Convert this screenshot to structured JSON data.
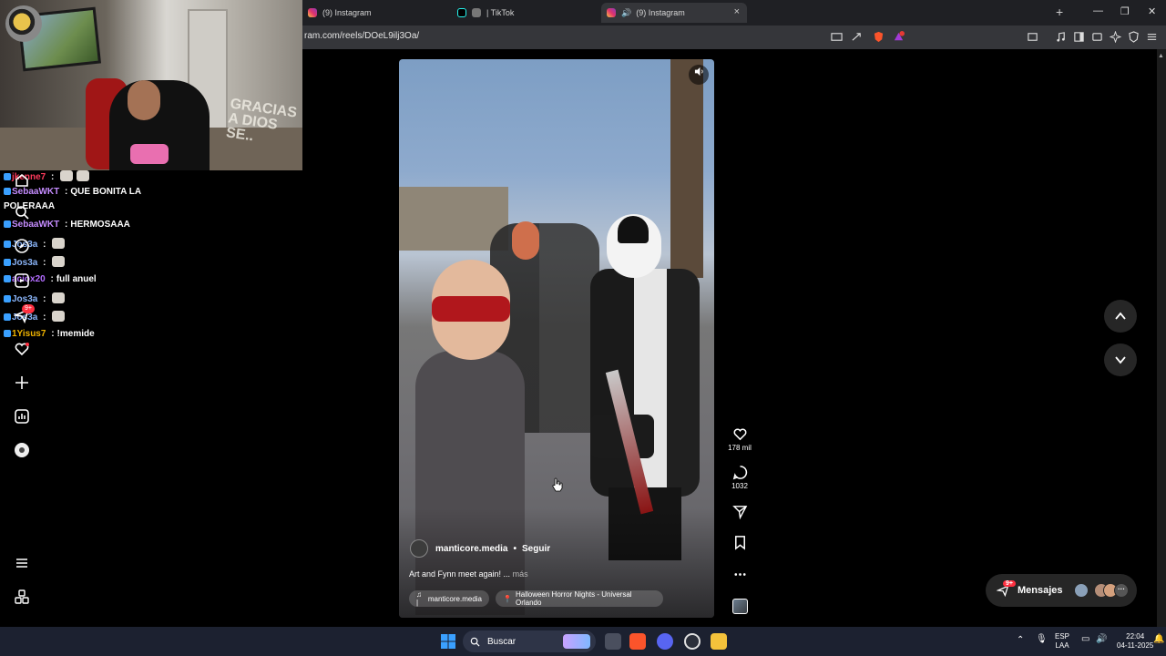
{
  "browser": {
    "tabs": [
      {
        "title": "(9) Instagram"
      },
      {
        "title": "| TikTok"
      },
      {
        "title": "(9) Instagram"
      }
    ],
    "url": "ram.com/reels/DOeL9ilj3Oa/",
    "new_tab_symbol": "+",
    "tab_close_symbol": "×",
    "window_controls": [
      "—",
      "❐",
      "✕"
    ]
  },
  "stream": {
    "wall_text": "GRACIAS A DIOS SE..",
    "chat": [
      {
        "user": "jkenne7",
        "user_color": "#ff3b5c",
        "sep": " :",
        "message": "",
        "emotes": 2
      },
      {
        "user": "SebaaWKT",
        "user_color": "#c58cff",
        "sep": " :",
        "message": "QUE BONITA LA",
        "emotes": 0
      },
      {
        "user": "",
        "user_color": "#ffffff",
        "sep": "",
        "message": "POLERAAA",
        "emotes": 0
      },
      {
        "user": "SebaaWKT",
        "user_color": "#c58cff",
        "sep": " :",
        "message": "HERMOSAAA",
        "emotes": 0
      },
      {
        "user": "Jos3a",
        "user_color": "#8ab4f8",
        "sep": " :",
        "message": "",
        "emotes": 1
      },
      {
        "user": "Jos3a",
        "user_color": "#8ab4f8",
        "sep": " :",
        "message": "",
        "emotes": 1
      },
      {
        "user": "aciox20",
        "user_color": "#b36cff",
        "sep": " :",
        "message": "full anuel",
        "emotes": 0
      },
      {
        "user": "Jos3a",
        "user_color": "#8ab4f8",
        "sep": " :",
        "message": "",
        "emotes": 1
      },
      {
        "user": "Jos3a",
        "user_color": "#8ab4f8",
        "sep": " :",
        "message": "",
        "emotes": 1
      },
      {
        "user": "1Yisus7",
        "user_color": "#f0b400",
        "sep": " :",
        "message": "!memide",
        "emotes": 0
      }
    ]
  },
  "instagram": {
    "nav_badge": "9+",
    "reel": {
      "author": "manticore.media",
      "dot": "•",
      "follow_label": "Seguir",
      "caption": "Art and Fynn meet again! ...",
      "more_label": "más",
      "audio": "manticore.media",
      "location": "Halloween Horror Nights - Universal Orlando"
    },
    "actions": {
      "likes": "178 mil",
      "comments": "1032"
    },
    "messages": {
      "label": "Mensajes",
      "badge": "9+"
    }
  },
  "taskbar": {
    "search_placeholder": "Buscar",
    "lang_line1": "ESP",
    "lang_line2": "LAA",
    "time": "22:04",
    "date": "04-11-2025"
  },
  "colors": {
    "instagram_badge": "#ff3040",
    "brave_orange": "#fb542b",
    "taskbar_bg": "#1c2130"
  }
}
